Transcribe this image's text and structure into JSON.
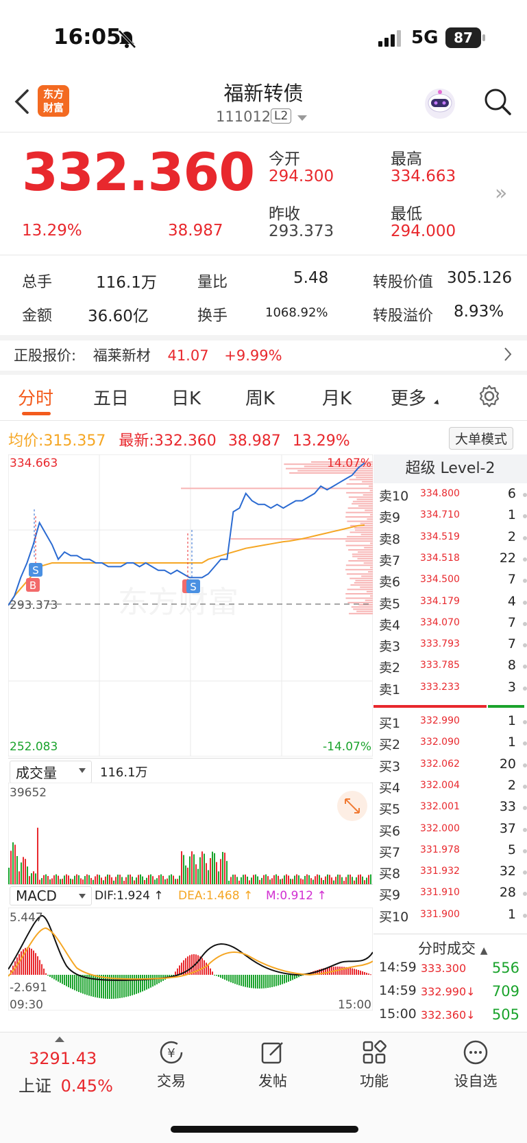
{
  "status_bar": {
    "time": "16:05",
    "network": "5G",
    "battery": "87"
  },
  "header": {
    "logo_text_1": "东方",
    "logo_text_2": "财富",
    "title": "福新转债",
    "code": "111012",
    "level_badge": "L2"
  },
  "quote": {
    "price": "332.360",
    "change_pct": "13.29%",
    "change": "38.987",
    "open_label": "今开",
    "open": "294.300",
    "high_label": "最高",
    "high": "334.663",
    "prev_close_label": "昨收",
    "prev_close": "293.373",
    "low_label": "最低",
    "low": "294.000"
  },
  "stats": {
    "volume_label": "总手",
    "volume": "116.1万",
    "ratio_label": "量比",
    "ratio": "5.48",
    "conv_value_label": "转股价值",
    "conv_value": "305.126",
    "amount_label": "金额",
    "amount": "36.60亿",
    "turnover_label": "换手",
    "turnover": "1068.92%",
    "premium_label": "转股溢价",
    "premium": "8.93%"
  },
  "underlying": {
    "label": "正股报价:",
    "name": "福莱新材",
    "price": "41.07",
    "change_pct": "+9.99%"
  },
  "tabs": [
    "分时",
    "五日",
    "日K",
    "周K",
    "月K",
    "更多"
  ],
  "avg": {
    "avg_label": "均价:",
    "avg_value": "315.357",
    "latest_label": "最新:",
    "latest_value": "332.360",
    "latest_change": "38.987",
    "latest_pct": "13.29%",
    "mode_button": "大单模式"
  },
  "chart_labels": {
    "top_left": "334.663",
    "top_right": "14.07%",
    "mid_left": "293.373",
    "bottom_left": "252.083",
    "bottom_right": "-14.07%",
    "volume_selector": "成交量",
    "volume_total": "116.1万",
    "volume_max": "39652",
    "macd_selector": "MACD",
    "dif": "DIF:1.924 ↑",
    "dea": "DEA:1.468 ↑",
    "m": "M:0.912 ↑",
    "macd_max": "5.447",
    "macd_min": "-2.691",
    "time_start": "09:30",
    "time_end": "15:00",
    "marker_s": "S",
    "marker_b": "B",
    "watermark": "东方财富"
  },
  "chart_data": {
    "type": "line",
    "x_range": [
      "09:30",
      "15:00"
    ],
    "ylim": [
      252.083,
      334.663
    ],
    "prev_close": 293.373,
    "series": [
      {
        "values": [
          293.4,
          296,
          301,
          305,
          310,
          316,
          313,
          310,
          306,
          308,
          307,
          307,
          306,
          306,
          305,
          305,
          304,
          304,
          304,
          305,
          305,
          304,
          305,
          304,
          303,
          303,
          302,
          303,
          302,
          301,
          301,
          301,
          302,
          304,
          306,
          306,
          319,
          320,
          324,
          322,
          321,
          321,
          320,
          321,
          320,
          321,
          322,
          322,
          323,
          324,
          326,
          325,
          326,
          327,
          328,
          329,
          331,
          332.36
        ]
      },
      {
        "values": [
          293.4,
          296,
          298,
          300,
          302,
          304,
          304.5,
          305,
          305,
          305,
          305,
          305,
          305,
          305,
          305,
          305,
          305,
          305,
          305,
          305,
          305,
          305,
          305,
          305,
          305,
          305,
          305,
          305,
          305,
          305,
          305,
          305,
          306,
          306.5,
          307,
          307.5,
          308,
          308.5,
          309,
          309.3,
          309.6,
          309.9,
          310.2,
          310.5,
          310.8,
          311,
          311.3,
          311.6,
          312,
          312.4,
          312.8,
          313.2,
          313.6,
          314,
          314.4,
          314.8,
          315.2,
          315.357
        ]
      }
    ]
  },
  "order_book": {
    "title": "超级 Level-2",
    "asks": [
      {
        "label": "卖10",
        "price": "334.800",
        "qty": "6"
      },
      {
        "label": "卖9",
        "price": "334.710",
        "qty": "1"
      },
      {
        "label": "卖8",
        "price": "334.519",
        "qty": "2"
      },
      {
        "label": "卖7",
        "price": "334.518",
        "qty": "22"
      },
      {
        "label": "卖6",
        "price": "334.500",
        "qty": "7"
      },
      {
        "label": "卖5",
        "price": "334.179",
        "qty": "4"
      },
      {
        "label": "卖4",
        "price": "334.070",
        "qty": "7"
      },
      {
        "label": "卖3",
        "price": "333.793",
        "qty": "7"
      },
      {
        "label": "卖2",
        "price": "333.785",
        "qty": "8"
      },
      {
        "label": "卖1",
        "price": "333.233",
        "qty": "3"
      }
    ],
    "bids": [
      {
        "label": "买1",
        "price": "332.990",
        "qty": "1"
      },
      {
        "label": "买2",
        "price": "332.090",
        "qty": "1"
      },
      {
        "label": "买3",
        "price": "332.062",
        "qty": "20"
      },
      {
        "label": "买4",
        "price": "332.004",
        "qty": "2"
      },
      {
        "label": "买5",
        "price": "332.001",
        "qty": "33"
      },
      {
        "label": "买6",
        "price": "332.000",
        "qty": "37"
      },
      {
        "label": "买7",
        "price": "331.978",
        "qty": "5"
      },
      {
        "label": "买8",
        "price": "331.932",
        "qty": "32"
      },
      {
        "label": "买9",
        "price": "331.910",
        "qty": "28"
      },
      {
        "label": "买10",
        "price": "331.900",
        "qty": "1"
      }
    ]
  },
  "trades": {
    "title": "分时成交",
    "rows": [
      {
        "time": "14:59",
        "price": "333.300",
        "qty": "556",
        "dir": ""
      },
      {
        "time": "14:59",
        "price": "332.990",
        "qty": "709",
        "dir": "↓"
      },
      {
        "time": "15:00",
        "price": "332.360",
        "qty": "505",
        "dir": "↓"
      }
    ]
  },
  "bottom_bar": {
    "index_value": "3291.43",
    "index_name": "上证",
    "index_pct": "0.45%",
    "items": [
      "交易",
      "发帖",
      "功能",
      "设自选"
    ]
  },
  "colors": {
    "up": "#e8282d",
    "down": "#1aa32c",
    "price_line": "#2a6ad1",
    "avg_line": "#f5a623",
    "accent": "#f35b1d"
  }
}
